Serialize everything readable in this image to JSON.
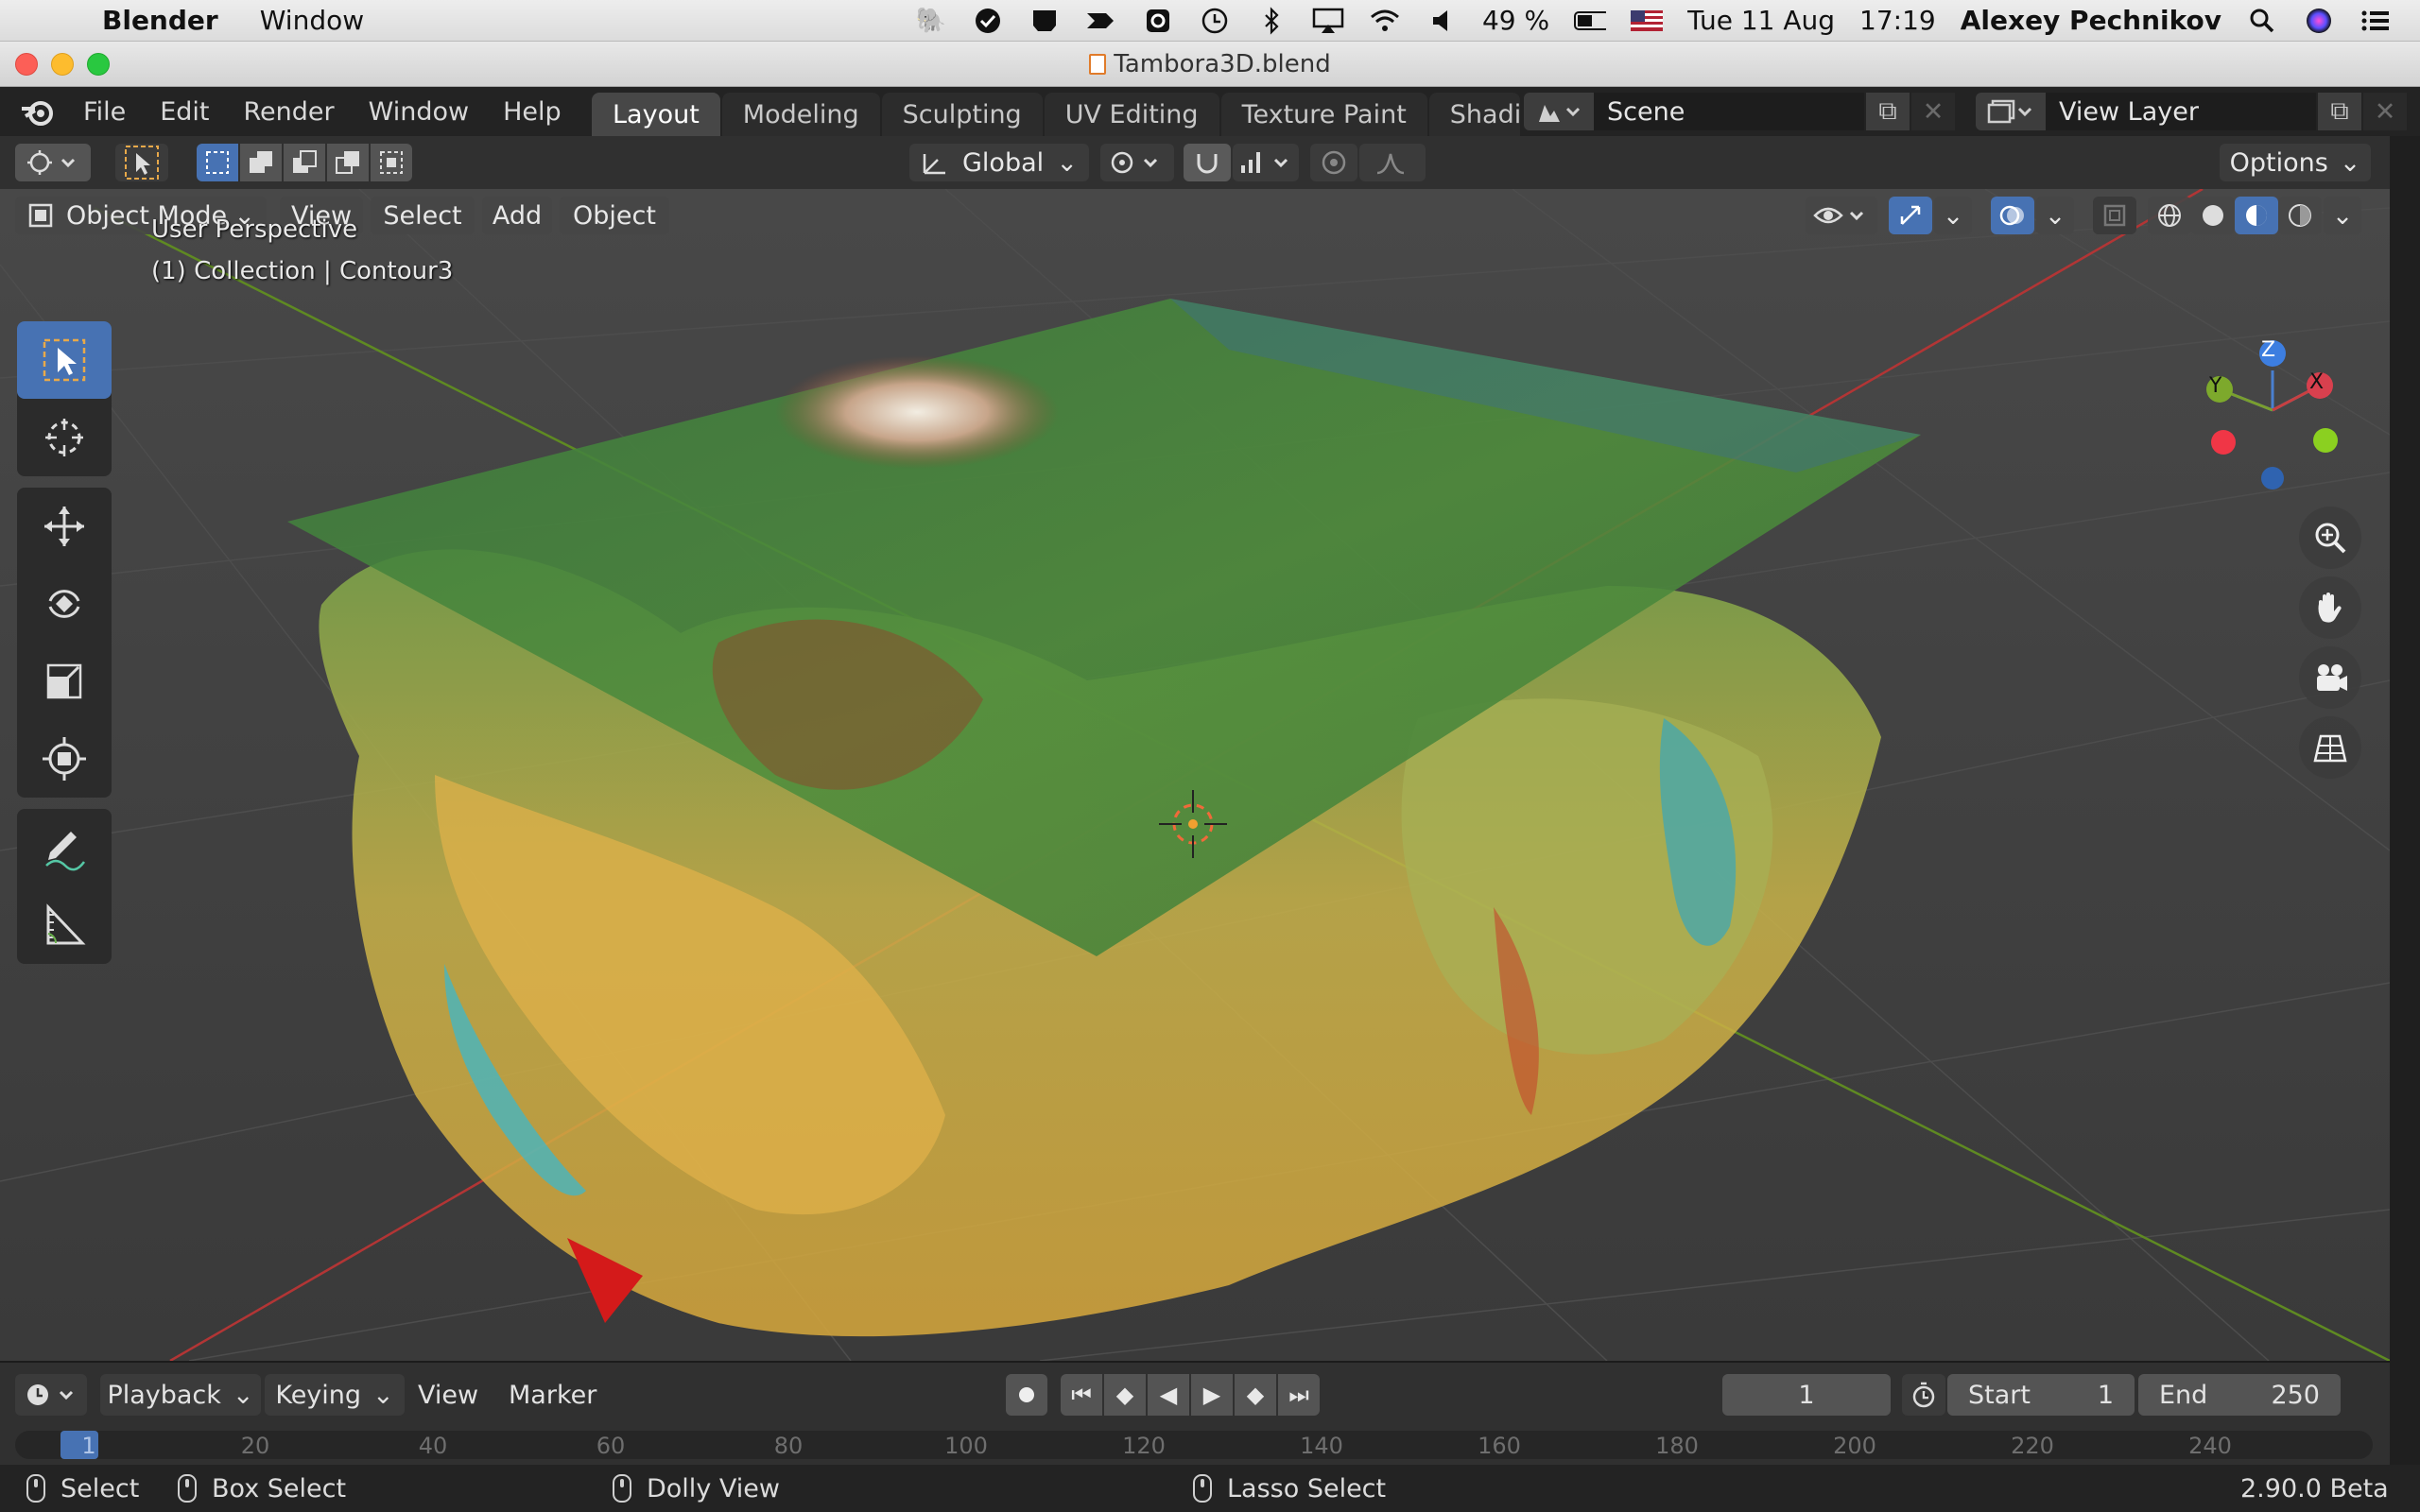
{
  "macos_menubar": {
    "app_name": "Blender",
    "menus": [
      "Window"
    ],
    "battery": "49 %",
    "date": "Tue 11 Aug",
    "time": "17:19",
    "user": "Alexey Pechnikov"
  },
  "window": {
    "title": "Tambora3D.blend"
  },
  "topbar": {
    "menus": [
      "File",
      "Edit",
      "Render",
      "Window",
      "Help"
    ],
    "workspace_tabs": [
      "Layout",
      "Modeling",
      "Sculpting",
      "UV Editing",
      "Texture Paint",
      "Shadin"
    ],
    "active_tab": "Layout",
    "scene": "Scene",
    "view_layer": "View Layer"
  },
  "header": {
    "orientation": "Global",
    "options_label": "Options"
  },
  "viewport": {
    "mode": "Object Mode",
    "menus": [
      "View",
      "Select",
      "Add",
      "Object"
    ],
    "perspective_label": "User Perspective",
    "collection_label": "(1) Collection | Contour3",
    "gizmo_axes": {
      "x": "X",
      "y": "Y",
      "z": "Z"
    },
    "colors": {
      "background": "#3d3d3d",
      "x_axis": "#c83232",
      "y_axis": "#6f9a26",
      "z_axis": "#3470c8",
      "accent": "#4772b3"
    }
  },
  "timeline": {
    "menus": [
      "Playback",
      "Keying",
      "View",
      "Marker"
    ],
    "current_frame": "1",
    "start_label": "Start",
    "start": "1",
    "end_label": "End",
    "end": "250",
    "ruler_ticks": [
      "1",
      "20",
      "40",
      "60",
      "80",
      "100",
      "120",
      "140",
      "160",
      "180",
      "200",
      "220",
      "240"
    ]
  },
  "statusbar": {
    "select": "Select",
    "box_select": "Box Select",
    "dolly_view": "Dolly View",
    "lasso_select": "Lasso Select",
    "version": "2.90.0 Beta"
  }
}
